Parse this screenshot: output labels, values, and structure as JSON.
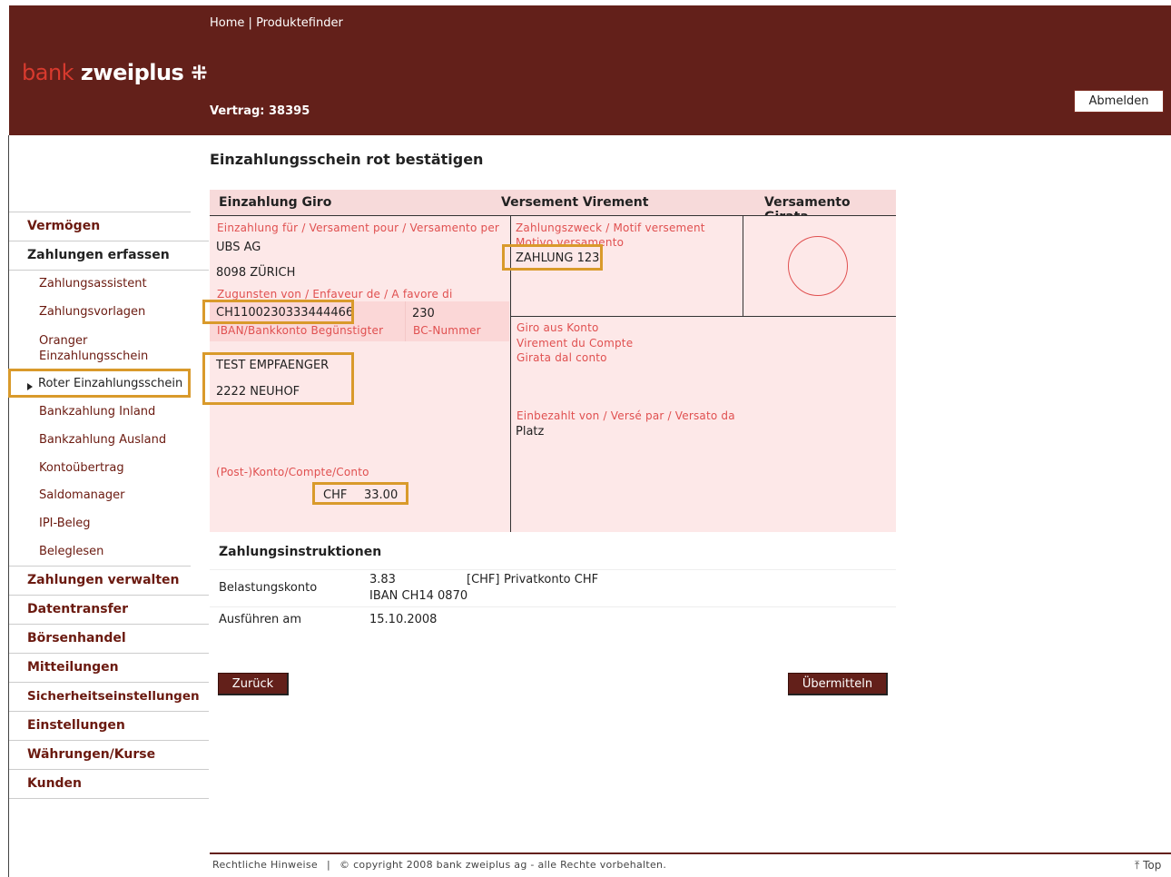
{
  "header": {
    "nav_home": "Home",
    "nav_sep": "|",
    "nav_finder": "Produktefinder",
    "logo_bank": "bank",
    "logo_name": "zweiplus",
    "contract": "Vertrag: 38395",
    "logout": "Abmelden"
  },
  "page_title": "Einzahlungsschein rot bestätigen",
  "sidebar": {
    "items": [
      {
        "label": "Vermögen"
      },
      {
        "label": "Zahlungen erfassen"
      },
      {
        "label": "Zahlungsassistent"
      },
      {
        "label": "Zahlungsvorlagen"
      },
      {
        "label": "Oranger Einzahlungsschein"
      },
      {
        "label": "Roter Einzahlungsschein"
      },
      {
        "label": "Bankzahlung Inland"
      },
      {
        "label": "Bankzahlung Ausland"
      },
      {
        "label": "Kontoübertrag"
      },
      {
        "label": "Saldomanager"
      },
      {
        "label": "IPI-Beleg"
      },
      {
        "label": "Beleglesen"
      },
      {
        "label": "Zahlungen verwalten"
      },
      {
        "label": "Datentransfer"
      },
      {
        "label": "Börsenhandel"
      },
      {
        "label": "Mitteilungen"
      },
      {
        "label": "Sicherheitseinstellungen"
      },
      {
        "label": "Einstellungen"
      },
      {
        "label": "Währungen/Kurse"
      },
      {
        "label": "Kunden"
      }
    ]
  },
  "slip": {
    "head_giro": "Einzahlung Giro",
    "head_virement": "Versement Virement",
    "head_girata": "Versamento Girata",
    "lbl_payment_for": "Einzahlung für / Versament pour / Versamento per",
    "bank_name": "UBS AG",
    "bank_city": "8098 ZÜRICH",
    "lbl_in_favor": "Zugunsten von / Enfaveur de / A favore di",
    "iban": "CH1100230333444466",
    "bc_number": "230",
    "lbl_iban": "IBAN/Bankkonto Begünstigter",
    "lbl_bc": "BC-Nummer",
    "recipient_name": "TEST EMPFAENGER",
    "recipient_city": "2222 NEUHOF",
    "lbl_account": "(Post-)Konto/Compte/Conto",
    "currency": "CHF",
    "amount": "33.00",
    "lbl_purpose_1": "Zahlungszweck / Motif versement",
    "lbl_purpose_2": "Motivo versamento",
    "purpose": "ZAHLUNG 123",
    "lbl_from_account_1": "Giro aus Konto",
    "lbl_from_account_2": "Virement du Compte",
    "lbl_from_account_3": "Girata dal conto",
    "lbl_paid_by": "Einbezahlt von / Versé par / Versato da",
    "paid_by": "Platz"
  },
  "instructions": {
    "title": "Zahlungsinstruktionen",
    "debit_label": "Belastungskonto",
    "debit_amount": "3.83",
    "debit_currency": "[CHF]",
    "debit_account": "Privatkonto CHF",
    "debit_iban": "IBAN  CH14 0870",
    "exec_label": "Ausführen am",
    "exec_date": "15.10.2008"
  },
  "buttons": {
    "back": "Zurück",
    "submit": "Übermitteln"
  },
  "footer": {
    "legal": "Rechtliche Hinweise",
    "sep": "|",
    "copyright": "© copyright 2008 bank zweiplus ag - alle Rechte vorbehalten.",
    "top": "⤒ Top"
  },
  "colors": {
    "brand": "#63201a",
    "highlight": "#d99a2b",
    "slip_bg": "#fde8e8",
    "slip_label": "#e05050"
  }
}
